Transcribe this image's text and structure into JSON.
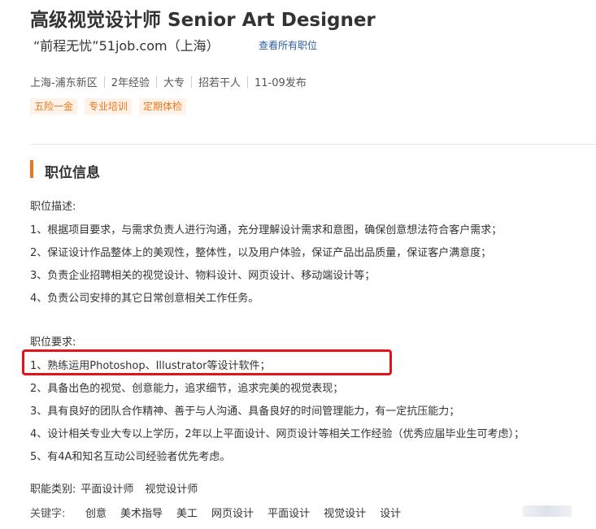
{
  "job": {
    "title": "高级视觉设计师 Senior Art Designer",
    "company": "“前程无忧”51job.com（上海）",
    "view_all_label": "查看所有职位"
  },
  "meta": [
    "上海-浦东新区",
    "2年经验",
    "大专",
    "招若干人",
    "11-09发布"
  ],
  "tags": [
    "五险一金",
    "专业培训",
    "定期体检"
  ],
  "section": {
    "title": "职位信息"
  },
  "description": {
    "heading": "职位描述:",
    "items": [
      "1、根据项目要求，与需求负责人进行沟通，充分理解设计需求和意图，确保创意想法符合客户需求；",
      "2、保证设计作品整体上的美观性，整体性，以及用户体验，保证产品出品质量，保证客户满意度；",
      "3、负责企业招聘相关的视觉设计、物料设计、网页设计、移动端设计等；",
      "4、负责公司安排的其它日常创意相关工作任务。"
    ]
  },
  "requirements": {
    "heading": "职位要求:",
    "items": [
      "1、熟练运用Photoshop、Illustrator等设计软件；",
      "2、具备出色的视觉、创意能力，追求细节，追求完美的视觉表现；",
      "3、具有良好的团队合作精神、善于与人沟通、具备良好的时间管理能力，有一定抗压能力；",
      "4、设计相关专业大专以上学历，2年以上平面设计、网页设计等相关工作经验（优秀应届毕业生可考虑）；",
      "5、有4A和知名互动公司经验者优先考虑。"
    ]
  },
  "category": {
    "label": "职能类别:",
    "items": [
      "平面设计师",
      "视觉设计师"
    ]
  },
  "keywords": {
    "label": "关键字:",
    "items": [
      "创意",
      "美术指导",
      "美工",
      "网页设计",
      "平面设计",
      "视觉设计",
      "设计"
    ]
  },
  "colors": {
    "accent": "#e8791a",
    "tag_bg": "#fff2e8",
    "link": "#2a5c9e",
    "highlight_box": "#e3121b"
  }
}
